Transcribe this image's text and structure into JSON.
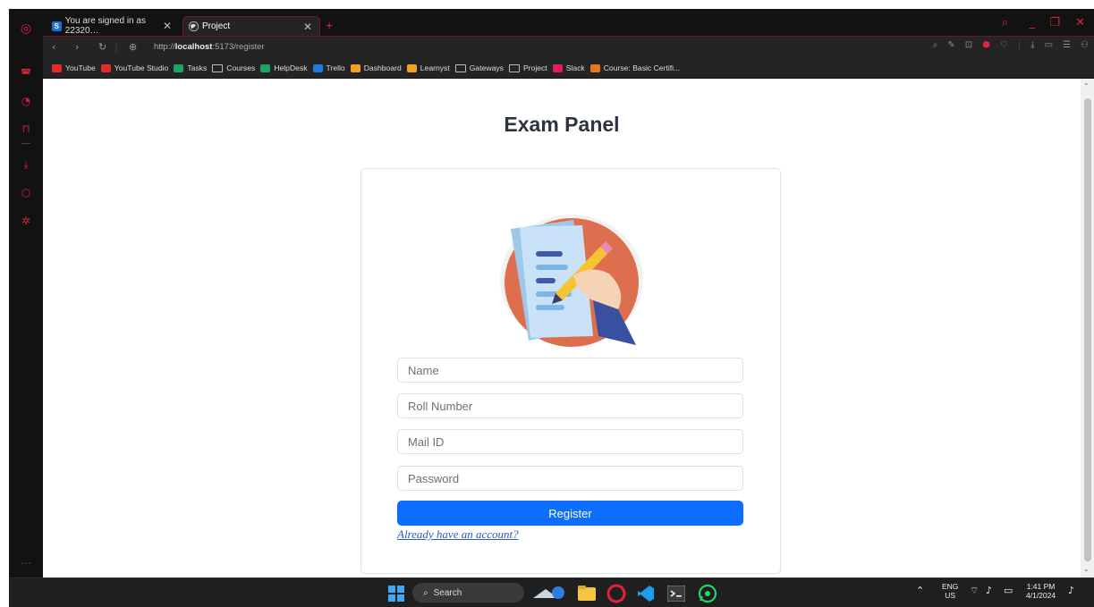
{
  "browser": {
    "tabs": [
      {
        "label": "You are signed in as 22320…",
        "favicon": "S"
      },
      {
        "label": "Project"
      }
    ],
    "url_prefix": "http://",
    "url_host": "localhost",
    "url_rest": ":5173/register",
    "bookmarks": [
      {
        "label": "YouTube",
        "icon": "youtube-icon",
        "color": "#e52d27"
      },
      {
        "label": "YouTube Studio",
        "icon": "youtube-studio-icon",
        "color": "#e52d27"
      },
      {
        "label": "Tasks",
        "icon": "tasks-icon",
        "color": "#1fa463"
      },
      {
        "label": "Courses",
        "icon": "folder-icon"
      },
      {
        "label": "HelpDesk",
        "icon": "helpdesk-icon",
        "color": "#1fa463"
      },
      {
        "label": "Trello",
        "icon": "trello-icon",
        "color": "#1e7ce0"
      },
      {
        "label": "Dashboard",
        "icon": "dashboard-icon",
        "color": "#f0a12a"
      },
      {
        "label": "Learnyst",
        "icon": "learnyst-icon",
        "color": "#f0a12a"
      },
      {
        "label": "Gateways",
        "icon": "folder-icon"
      },
      {
        "label": "Project",
        "icon": "folder-icon"
      },
      {
        "label": "Slack",
        "icon": "slack-icon",
        "color": "#e01e5a"
      },
      {
        "label": "Course: Basic Certifi...",
        "icon": "course-icon",
        "color": "#e8761a"
      }
    ]
  },
  "page": {
    "title": "Exam Panel",
    "form": {
      "name_placeholder": "Name",
      "roll_placeholder": "Roll Number",
      "mail_placeholder": "Mail ID",
      "password_placeholder": "Password",
      "register_label": "Register",
      "login_link": "Already have an account?"
    }
  },
  "taskbar": {
    "search_label": "Search",
    "lang_top": "ENG",
    "lang_bottom": "US",
    "time": "1:41 PM",
    "date": "4/1/2024"
  },
  "colors": {
    "accent": "#0d6efd",
    "opera_red": "#d2243a"
  }
}
